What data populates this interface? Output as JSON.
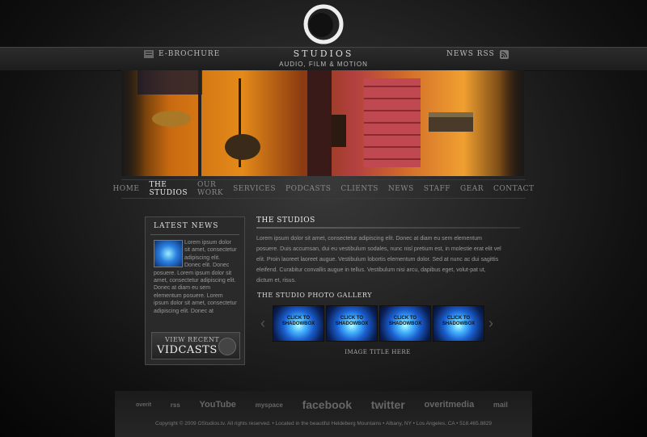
{
  "header": {
    "brand": "STUDIOS",
    "tagline": "AUDIO, FILM & MOTION",
    "ebrochure_label": "E-BROCHURE",
    "newsrss_label": "NEWS RSS"
  },
  "nav": {
    "items": [
      "HOME",
      "THE STUDIOS",
      "OUR WORK",
      "SERVICES",
      "PODCASTS",
      "CLIENTS",
      "NEWS",
      "STAFF",
      "GEAR",
      "CONTACT"
    ],
    "active": "THE STUDIOS"
  },
  "sidebar": {
    "title": "LATEST NEWS",
    "body": "Lorem ipsum dolor sit amet, consectetur adipiscing elit. Donec elit. Donec posuere. Lorem ipsum dolor sit amet, consectetur adipiscing elit. Donec at diam eu sem elementum posuere. Lorem ipsum dolor sit amet, consectetur adipiscing elit. Donec at",
    "vidcasts_small": "VIEW RECENT",
    "vidcasts_big": "VIDCASTS"
  },
  "main": {
    "title": "THE STUDIOS",
    "body": "Lorem ipsum dolor sit amet, consectetur adipiscing elit. Donec at diam eu sem elementum posuere. Duis accumsan, dui eu vestibulum sodales, nunc nisl pretium est, in molestie erat elit vel elit. Proin laoreet laoreet augue. Vestibulum lobortis elementum dolor. Sed at nunc ac dui sagittis eleifend. Curabitur convallis augue in tellus. Vestibulum nisi arcu, dapibus eget, volut-pat ut, dictum et, risus.",
    "gallery_title": "THE STUDIO PHOTO GALLERY",
    "thumb_label": "CLICK TO SHADOWBOX",
    "image_title": "IMAGE TITLE HERE"
  },
  "footer": {
    "icons": [
      "overit",
      "rss",
      "YouTube",
      "myspace",
      "facebook",
      "twitter",
      "overitmedia",
      "mail"
    ],
    "copyright": "Copyright © 2009 OStudios.tv. All rights reserved. • Located in the beautiful Heldeberg Mountains • Albany, NY • Los Angeles, CA • 518.465.8829"
  }
}
